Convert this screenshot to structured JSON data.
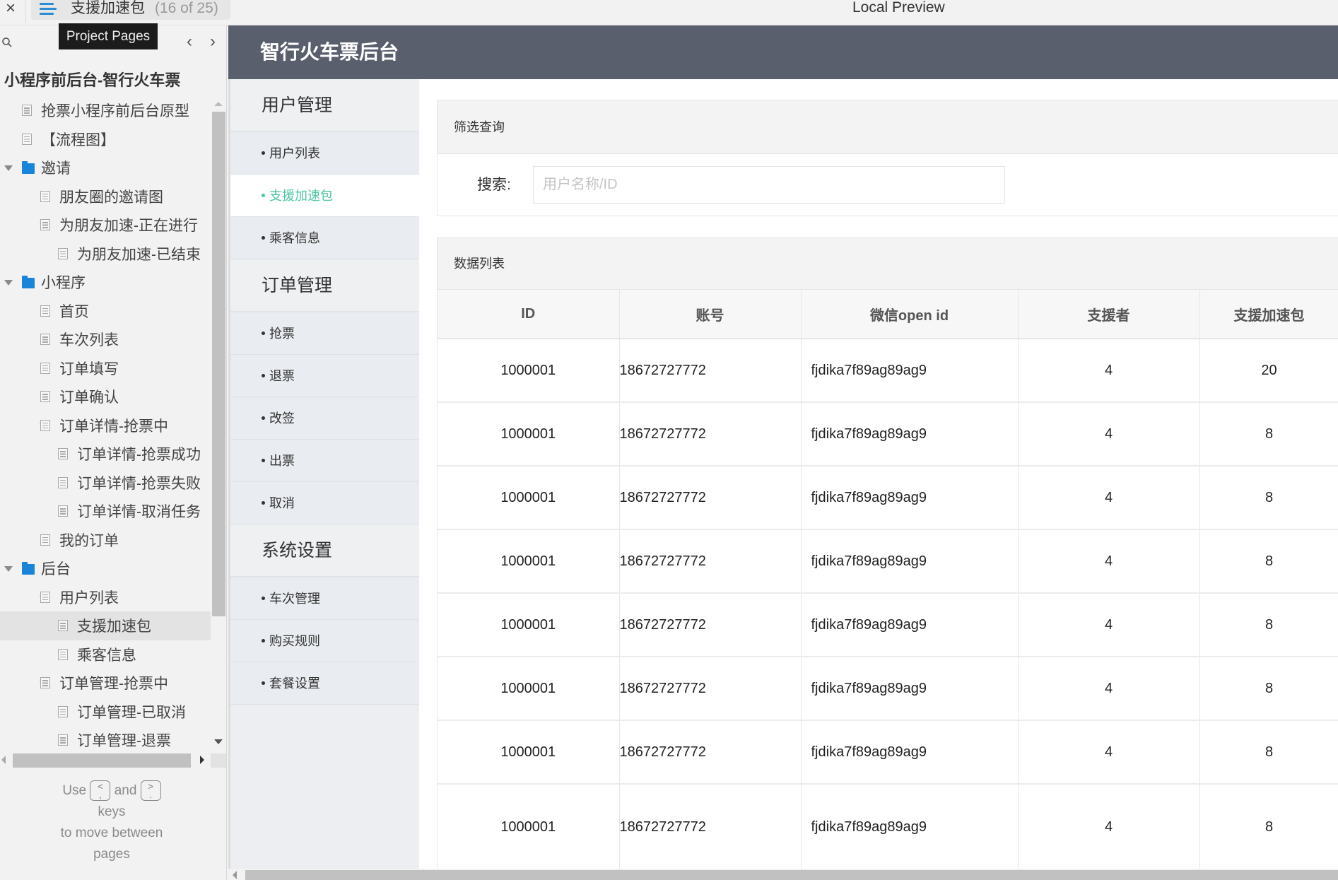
{
  "topbar": {
    "close_icon": "×",
    "page_title": "支援加速包",
    "page_count": "(16 of 25)",
    "preview_title": "Local Preview"
  },
  "left_panel": {
    "tooltip": "Project Pages",
    "prev_icon": "‹",
    "next_icon": "›",
    "project_title": "小程序前后台-智行火车票",
    "tree": [
      {
        "label": "抢票小程序前后台原型",
        "type": "page",
        "level": 1,
        "expanded": null,
        "selected": false
      },
      {
        "label": "【流程图】",
        "type": "page",
        "level": 1,
        "expanded": null,
        "selected": false
      },
      {
        "label": "邀请",
        "type": "folder",
        "level": 0,
        "expanded": true,
        "selected": false
      },
      {
        "label": "朋友圈的邀请图",
        "type": "page",
        "level": 2,
        "expanded": null,
        "selected": false
      },
      {
        "label": "为朋友加速-正在进行",
        "type": "page",
        "level": 2,
        "expanded": true,
        "selected": false
      },
      {
        "label": "为朋友加速-已结束",
        "type": "page",
        "level": 3,
        "expanded": null,
        "selected": false
      },
      {
        "label": "小程序",
        "type": "folder",
        "level": 0,
        "expanded": true,
        "selected": false
      },
      {
        "label": "首页",
        "type": "page",
        "level": 2,
        "expanded": null,
        "selected": false
      },
      {
        "label": "车次列表",
        "type": "page",
        "level": 2,
        "expanded": null,
        "selected": false
      },
      {
        "label": "订单填写",
        "type": "page",
        "level": 2,
        "expanded": null,
        "selected": false
      },
      {
        "label": "订单确认",
        "type": "page",
        "level": 2,
        "expanded": null,
        "selected": false
      },
      {
        "label": "订单详情-抢票中",
        "type": "page",
        "level": 2,
        "expanded": true,
        "selected": false
      },
      {
        "label": "订单详情-抢票成功",
        "type": "page",
        "level": 3,
        "expanded": null,
        "selected": false
      },
      {
        "label": "订单详情-抢票失败",
        "type": "page",
        "level": 3,
        "expanded": null,
        "selected": false
      },
      {
        "label": "订单详情-取消任务",
        "type": "page",
        "level": 3,
        "expanded": null,
        "selected": false
      },
      {
        "label": "我的订单",
        "type": "page",
        "level": 2,
        "expanded": null,
        "selected": false
      },
      {
        "label": "后台",
        "type": "folder",
        "level": 0,
        "expanded": true,
        "selected": false
      },
      {
        "label": "用户列表",
        "type": "page",
        "level": 2,
        "expanded": true,
        "selected": false
      },
      {
        "label": "支援加速包",
        "type": "page",
        "level": 3,
        "expanded": null,
        "selected": true
      },
      {
        "label": "乘客信息",
        "type": "page",
        "level": 3,
        "expanded": null,
        "selected": false
      },
      {
        "label": "订单管理-抢票中",
        "type": "page",
        "level": 2,
        "expanded": true,
        "selected": false
      },
      {
        "label": "订单管理-已取消",
        "type": "page",
        "level": 3,
        "expanded": null,
        "selected": false
      },
      {
        "label": "订单管理-退票",
        "type": "page",
        "level": 3,
        "expanded": null,
        "selected": false
      }
    ],
    "hint": {
      "use": "Use",
      "key_prev": "<\n,",
      "and": "and",
      "key_next": ">\n.",
      "keys": "keys",
      "line2": "to move between",
      "line3": "pages"
    }
  },
  "app": {
    "title": "智行火车票后台",
    "accent_color": "#4bc5a3",
    "header_color": "#5a5f6e",
    "nav": {
      "groups": [
        {
          "label": "用户管理",
          "items": [
            {
              "label": "用户列表",
              "active": false
            },
            {
              "label": "支援加速包",
              "active": true
            },
            {
              "label": "乘客信息",
              "active": false
            }
          ]
        },
        {
          "label": "订单管理",
          "items": [
            {
              "label": "抢票",
              "active": false
            },
            {
              "label": "退票",
              "active": false
            },
            {
              "label": "改签",
              "active": false
            },
            {
              "label": "出票",
              "active": false
            },
            {
              "label": "取消",
              "active": false
            }
          ]
        },
        {
          "label": "系统设置",
          "items": [
            {
              "label": "车次管理",
              "active": false
            },
            {
              "label": "购买规则",
              "active": false
            },
            {
              "label": "套餐设置",
              "active": false
            }
          ]
        }
      ]
    },
    "filter": {
      "heading": "筛选查询",
      "search_label": "搜索:",
      "search_placeholder": "用户名称/ID",
      "search_value": ""
    },
    "list": {
      "heading": "数据列表",
      "columns": [
        "ID",
        "账号",
        "微信open id",
        "支援者",
        "支援加速包"
      ],
      "rows": [
        [
          "1000001",
          "18672727772",
          "fjdika7f89ag89ag9",
          "4",
          "20"
        ],
        [
          "1000001",
          "18672727772",
          "fjdika7f89ag89ag9",
          "4",
          "8"
        ],
        [
          "1000001",
          "18672727772",
          "fjdika7f89ag89ag9",
          "4",
          "8"
        ],
        [
          "1000001",
          "18672727772",
          "fjdika7f89ag89ag9",
          "4",
          "8"
        ],
        [
          "1000001",
          "18672727772",
          "fjdika7f89ag89ag9",
          "4",
          "8"
        ],
        [
          "1000001",
          "18672727772",
          "fjdika7f89ag89ag9",
          "4",
          "8"
        ],
        [
          "1000001",
          "18672727772",
          "fjdika7f89ag89ag9",
          "4",
          "8"
        ],
        [
          "1000001",
          "18672727772",
          "fjdika7f89ag89ag9",
          "4",
          "8"
        ]
      ]
    }
  }
}
